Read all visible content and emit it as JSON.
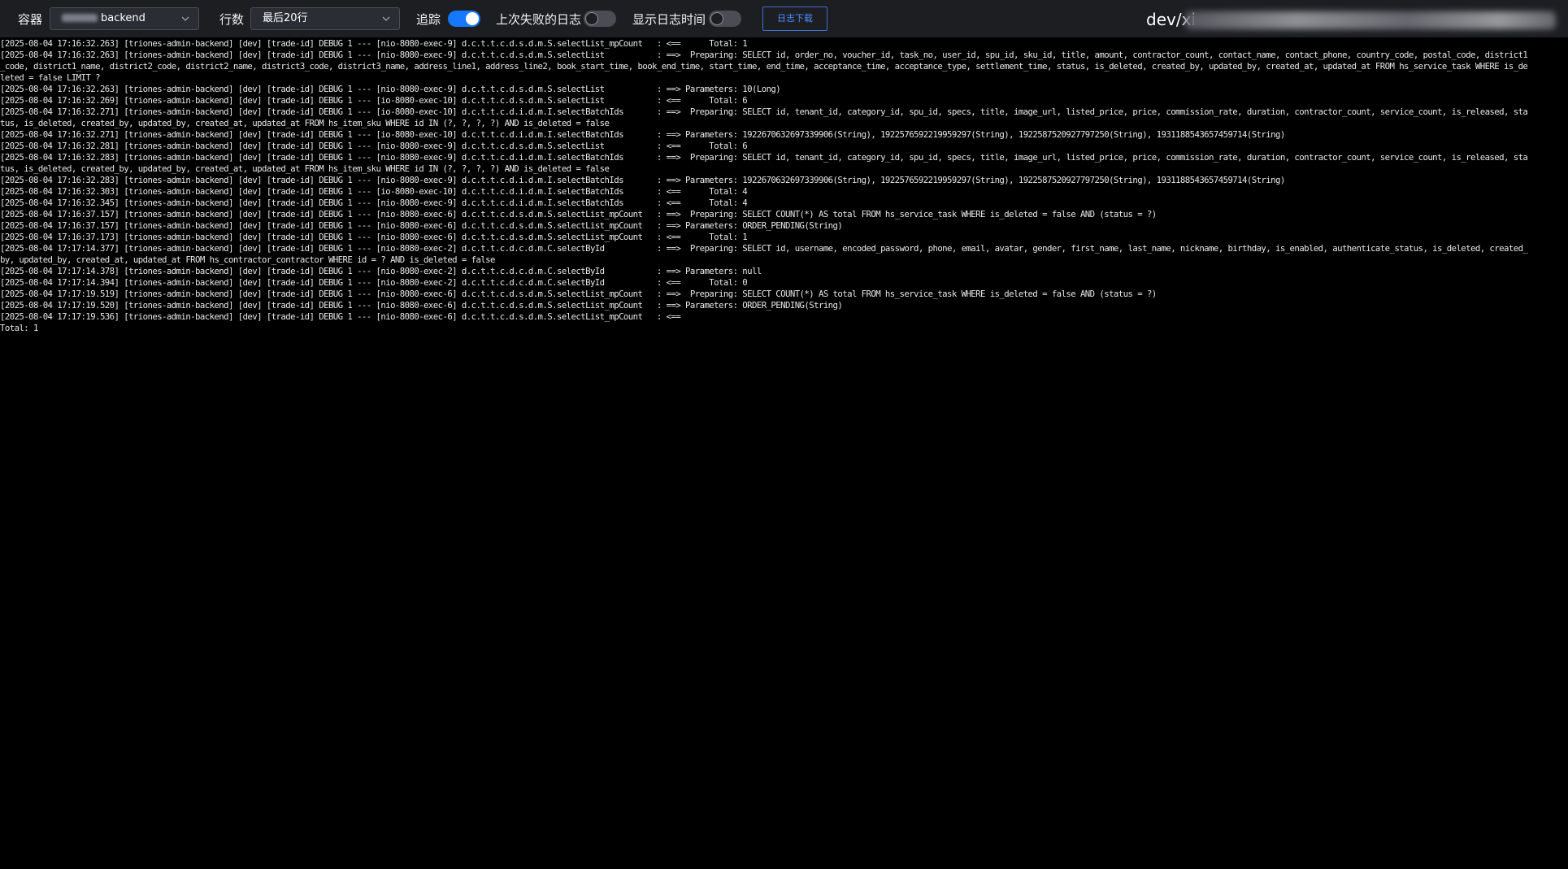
{
  "toolbar": {
    "container_label": "容器",
    "container_value": "backend",
    "rows_label": "行数",
    "rows_value": "最后20行",
    "follow_label": "追踪",
    "follow_on": true,
    "last_failed_label": "上次失败的日志",
    "last_failed_on": false,
    "show_time_label": "显示日志时间",
    "show_time_on": false,
    "download_label": "日志下载",
    "path_title": "dev/xi"
  },
  "colors": {
    "background": "#000000",
    "toolbar_bg": "#1c1e22",
    "accent": "#1677ff",
    "text": "#e8e8e8"
  },
  "icons": {
    "select_chevron": "chevron-down-icon"
  },
  "log_lines": [
    "[2025-08-04 17:16:32.263] [triones-admin-backend] [dev] [trade-id] DEBUG 1 --- [nio-8080-exec-9] d.c.t.t.c.d.s.d.m.S.selectList_mpCount   : <==      Total: 1",
    "[2025-08-04 17:16:32.263] [triones-admin-backend] [dev] [trade-id] DEBUG 1 --- [nio-8080-exec-9] d.c.t.t.c.d.s.d.m.S.selectList           : ==>  Preparing: SELECT id, order_no, voucher_id, task_no, user_id, spu_id, sku_id, title, amount, contractor_count, contact_name, contact_phone, country_code, postal_code, district1",
    "_code, district1_name, district2_code, district2_name, district3_code, district3_name, address_line1, address_line2, book_start_time, book_end_time, start_time, end_time, acceptance_time, acceptance_type, settlement_time, status, is_deleted, created_by, updated_by, created_at, updated_at FROM hs_service_task WHERE is_de",
    "leted = false LIMIT ?",
    "[2025-08-04 17:16:32.263] [triones-admin-backend] [dev] [trade-id] DEBUG 1 --- [nio-8080-exec-9] d.c.t.t.c.d.s.d.m.S.selectList           : ==> Parameters: 10(Long)",
    "[2025-08-04 17:16:32.269] [triones-admin-backend] [dev] [trade-id] DEBUG 1 --- [io-8080-exec-10] d.c.t.t.c.d.s.d.m.S.selectList           : <==      Total: 6",
    "[2025-08-04 17:16:32.271] [triones-admin-backend] [dev] [trade-id] DEBUG 1 --- [io-8080-exec-10] d.c.t.t.c.d.i.d.m.I.selectBatchIds       : ==>  Preparing: SELECT id, tenant_id, category_id, spu_id, specs, title, image_url, listed_price, price, commission_rate, duration, contractor_count, service_count, is_released, sta",
    "tus, is_deleted, created_by, updated_by, created_at, updated_at FROM hs_item_sku WHERE id IN (?, ?, ?, ?) AND is_deleted = false",
    "[2025-08-04 17:16:32.271] [triones-admin-backend] [dev] [trade-id] DEBUG 1 --- [io-8080-exec-10] d.c.t.t.c.d.i.d.m.I.selectBatchIds       : ==> Parameters: 1922670632697339906(String), 1922576592219959297(String), 1922587520927797250(String), 1931188543657459714(String)",
    "[2025-08-04 17:16:32.281] [triones-admin-backend] [dev] [trade-id] DEBUG 1 --- [nio-8080-exec-9] d.c.t.t.c.d.s.d.m.S.selectList           : <==      Total: 6",
    "[2025-08-04 17:16:32.283] [triones-admin-backend] [dev] [trade-id] DEBUG 1 --- [nio-8080-exec-9] d.c.t.t.c.d.i.d.m.I.selectBatchIds       : ==>  Preparing: SELECT id, tenant_id, category_id, spu_id, specs, title, image_url, listed_price, price, commission_rate, duration, contractor_count, service_count, is_released, sta",
    "tus, is_deleted, created_by, updated_by, created_at, updated_at FROM hs_item_sku WHERE id IN (?, ?, ?, ?) AND is_deleted = false",
    "[2025-08-04 17:16:32.283] [triones-admin-backend] [dev] [trade-id] DEBUG 1 --- [nio-8080-exec-9] d.c.t.t.c.d.i.d.m.I.selectBatchIds       : ==> Parameters: 1922670632697339906(String), 1922576592219959297(String), 1922587520927797250(String), 1931188543657459714(String)",
    "[2025-08-04 17:16:32.303] [triones-admin-backend] [dev] [trade-id] DEBUG 1 --- [io-8080-exec-10] d.c.t.t.c.d.i.d.m.I.selectBatchIds       : <==      Total: 4",
    "[2025-08-04 17:16:32.345] [triones-admin-backend] [dev] [trade-id] DEBUG 1 --- [nio-8080-exec-9] d.c.t.t.c.d.i.d.m.I.selectBatchIds       : <==      Total: 4",
    "[2025-08-04 17:16:37.157] [triones-admin-backend] [dev] [trade-id] DEBUG 1 --- [nio-8080-exec-6] d.c.t.t.c.d.s.d.m.S.selectList_mpCount   : ==>  Preparing: SELECT COUNT(*) AS total FROM hs_service_task WHERE is_deleted = false AND (status = ?)",
    "[2025-08-04 17:16:37.157] [triones-admin-backend] [dev] [trade-id] DEBUG 1 --- [nio-8080-exec-6] d.c.t.t.c.d.s.d.m.S.selectList_mpCount   : ==> Parameters: ORDER_PENDING(String)",
    "[2025-08-04 17:16:37.173] [triones-admin-backend] [dev] [trade-id] DEBUG 1 --- [nio-8080-exec-6] d.c.t.t.c.d.s.d.m.S.selectList_mpCount   : <==      Total: 1",
    "[2025-08-04 17:17:14.377] [triones-admin-backend] [dev] [trade-id] DEBUG 1 --- [nio-8080-exec-2] d.c.t.t.c.d.c.d.m.C.selectById           : ==>  Preparing: SELECT id, username, encoded_password, phone, email, avatar, gender, first_name, last_name, nickname, birthday, is_enabled, authenticate_status, is_deleted, created_",
    "by, updated_by, created_at, updated_at FROM hs_contractor_contractor WHERE id = ? AND is_deleted = false",
    "[2025-08-04 17:17:14.378] [triones-admin-backend] [dev] [trade-id] DEBUG 1 --- [nio-8080-exec-2] d.c.t.t.c.d.c.d.m.C.selectById           : ==> Parameters: null",
    "[2025-08-04 17:17:14.394] [triones-admin-backend] [dev] [trade-id] DEBUG 1 --- [nio-8080-exec-2] d.c.t.t.c.d.c.d.m.C.selectById           : <==      Total: 0",
    "[2025-08-04 17:17:19.519] [triones-admin-backend] [dev] [trade-id] DEBUG 1 --- [nio-8080-exec-6] d.c.t.t.c.d.s.d.m.S.selectList_mpCount   : ==>  Preparing: SELECT COUNT(*) AS total FROM hs_service_task WHERE is_deleted = false AND (status = ?)",
    "[2025-08-04 17:17:19.520] [triones-admin-backend] [dev] [trade-id] DEBUG 1 --- [nio-8080-exec-6] d.c.t.t.c.d.s.d.m.S.selectList_mpCount   : ==> Parameters: ORDER_PENDING(String)",
    "[2025-08-04 17:17:19.536] [triones-admin-backend] [dev] [trade-id] DEBUG 1 --- [nio-8080-exec-6] d.c.t.t.c.d.s.d.m.S.selectList_mpCount   : <==",
    "Total: 1"
  ]
}
